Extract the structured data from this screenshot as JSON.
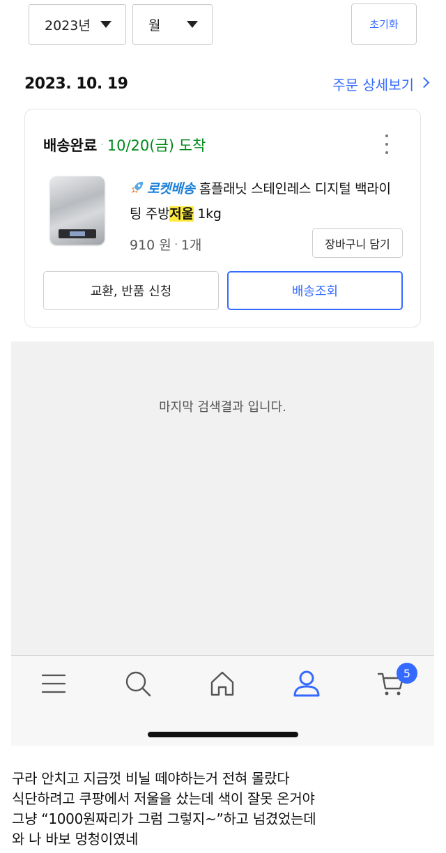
{
  "filters": {
    "year_label": "2023년",
    "month_label": "월",
    "reset_label": "초기화"
  },
  "order": {
    "date": "2023. 10. 19",
    "detail_link": "주문 상세보기",
    "status": "배송완료",
    "arrival": "10/20(금) 도착",
    "rocket_label": "로켓배송",
    "product_name_pre": "홈플래닛 스테인레스 디지털 백라이팅 주방",
    "product_name_highlight": "저울",
    "product_name_post": " 1kg",
    "price": "910 원",
    "quantity": "1개",
    "add_to_cart_label": "장바구니 담기",
    "exchange_label": "교환, 반품 신청",
    "track_label": "배송조회"
  },
  "end_message": "마지막 검색결과 입니다.",
  "bottom_nav": {
    "cart_badge": "5",
    "icons": [
      "menu-icon",
      "search-icon",
      "home-icon",
      "user-icon",
      "cart-icon"
    ],
    "active_color": "#346aff"
  },
  "caption": {
    "lines": [
      "구라 안치고 지금껏 비닐 떼야하는거 전혀 몰랐다",
      "식단하려고 쿠팡에서 저울을 샀는데 색이 잘못 온거야",
      "그냥 “1000원짜리가 그럼 그렇지~”하고 넘겼었는데",
      "와 나 바보 멍청이였네"
    ]
  },
  "colors": {
    "accent": "#346aff",
    "arrival_green": "#00891a",
    "highlight": "#ffeb3b"
  }
}
